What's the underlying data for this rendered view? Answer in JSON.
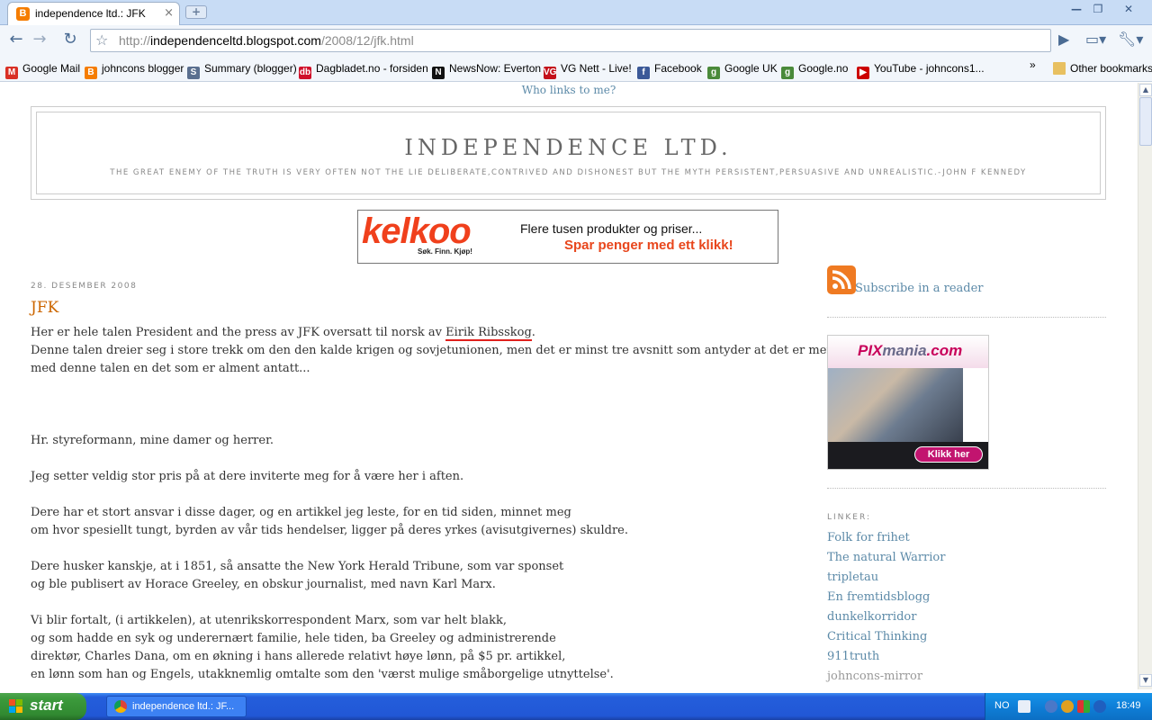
{
  "browser": {
    "tab_title": "independence ltd.: JFK",
    "tab_close": "×",
    "new_tab": "+",
    "window_buttons": {
      "minimize": "—",
      "restore": "❐",
      "close": "✕"
    },
    "url": {
      "host_prefix": "http://",
      "domain": "independenceltd.blogspot.com",
      "path": "/2008/12/jfk.html"
    },
    "bookmarks": [
      {
        "label": "Google Mail",
        "icon": "gmail-icon",
        "color": "#d93025",
        "glyph": "M"
      },
      {
        "label": "johncons blogger",
        "icon": "blogger-icon",
        "color": "#f57d00",
        "glyph": "B"
      },
      {
        "label": "Summary (blogger)",
        "icon": "summary-icon",
        "color": "#5a6f8f",
        "glyph": "S"
      },
      {
        "label": "Dagbladet.no - forsiden",
        "icon": "dagbladet-icon",
        "color": "#d0102a",
        "glyph": "db"
      },
      {
        "label": "NewsNow: Everton",
        "icon": "newsnow-icon",
        "color": "#111111",
        "glyph": "N"
      },
      {
        "label": "VG Nett - Live!",
        "icon": "vg-icon",
        "color": "#c4111b",
        "glyph": "VG"
      },
      {
        "label": "Facebook",
        "icon": "facebook-icon",
        "color": "#3b5998",
        "glyph": "f"
      },
      {
        "label": "Google UK",
        "icon": "google-icon",
        "color": "#4a8a3a",
        "glyph": "g"
      },
      {
        "label": "Google.no",
        "icon": "google-icon",
        "color": "#4a8a3a",
        "glyph": "g"
      },
      {
        "label": "YouTube - johncons1...",
        "icon": "youtube-icon",
        "color": "#cc0000",
        "glyph": "▶"
      }
    ],
    "bookmarks_overflow": "»",
    "other_bookmarks": "Other bookmarks"
  },
  "page": {
    "who_links": "Who links to me?",
    "blog_title": "INDEPENDENCE LTD.",
    "blog_description": "THE GREAT ENEMY OF THE TRUTH IS VERY OFTEN NOT THE LIE DELIBERATE,CONTRIVED AND DISHONEST BUT THE MYTH PERSISTENT,PERSUASIVE AND UNREALISTIC.-JOHN F KENNEDY",
    "ad_kelkoo": {
      "logo": "kelkoo",
      "tagline": "Søk. Finn. Kjøp!",
      "line1": "Flere tusen produkter og priser...",
      "line2": "Spar penger med ett klikk!"
    },
    "post": {
      "date": "28. DESEMBER 2008",
      "title": "JFK",
      "intro_before_link": "Her er hele talen President and the press av JFK oversatt til norsk av ",
      "intro_link": "Eirik Ribsskog",
      "intro_after_link": ".",
      "intro_lines": [
        "Denne talen dreier seg i store trekk om den den kalde krigen og sovjetunionen, men det er minst tre avsnitt som antyder at det er mer",
        "med denne talen en det som er alment antatt..."
      ],
      "paragraphs": [
        [
          "Hr. styreformann, mine damer og herrer."
        ],
        [
          "Jeg setter veldig stor pris på at dere inviterte meg for å være her i aften."
        ],
        [
          "Dere har et stort ansvar i disse dager, og en artikkel jeg leste, for en tid siden, minnet meg",
          "om hvor spesiellt tungt, byrden av vår tids hendelser, ligger på deres yrkes (avisutgivernes) skuldre."
        ],
        [
          "Dere husker kanskje, at i 1851, så ansatte the New York Herald Tribune, som var sponset",
          "og ble publisert av Horace Greeley, en obskur journalist, med navn Karl Marx."
        ],
        [
          "Vi blir fortalt, (i artikkelen), at utenrikskorrespondent Marx, som var helt blakk,",
          "og som hadde en syk og underernært familie, hele tiden, ba Greeley og administrerende",
          "direktør, Charles Dana, om en økning i hans allerede relativt høye lønn, på $5 pr. artikkel,",
          "en lønn som han og Engels, utakknemlig omtalte som den 'værst mulige småborgelige utnyttelse'."
        ]
      ]
    },
    "sidebar": {
      "subscribe": "Subscribe in a reader",
      "ad_pixmania": {
        "brand_a": "PIX",
        "brand_b": "mania",
        "brand_c": ".com",
        "button": "Klikk her"
      },
      "links_heading": "LINKER:",
      "links": [
        {
          "label": "Folk for frihet",
          "visited": false
        },
        {
          "label": "The natural Warrior",
          "visited": false
        },
        {
          "label": "tripletau",
          "visited": false
        },
        {
          "label": "En fremtidsblogg",
          "visited": false
        },
        {
          "label": "dunkelkorridor",
          "visited": false
        },
        {
          "label": "Critical Thinking",
          "visited": false
        },
        {
          "label": "911truth",
          "visited": false
        },
        {
          "label": "johncons-mirror",
          "visited": true
        }
      ]
    }
  },
  "taskbar": {
    "start_label": "start",
    "task_title": "independence ltd.: JF...",
    "language": "NO",
    "clock": "18:49"
  }
}
